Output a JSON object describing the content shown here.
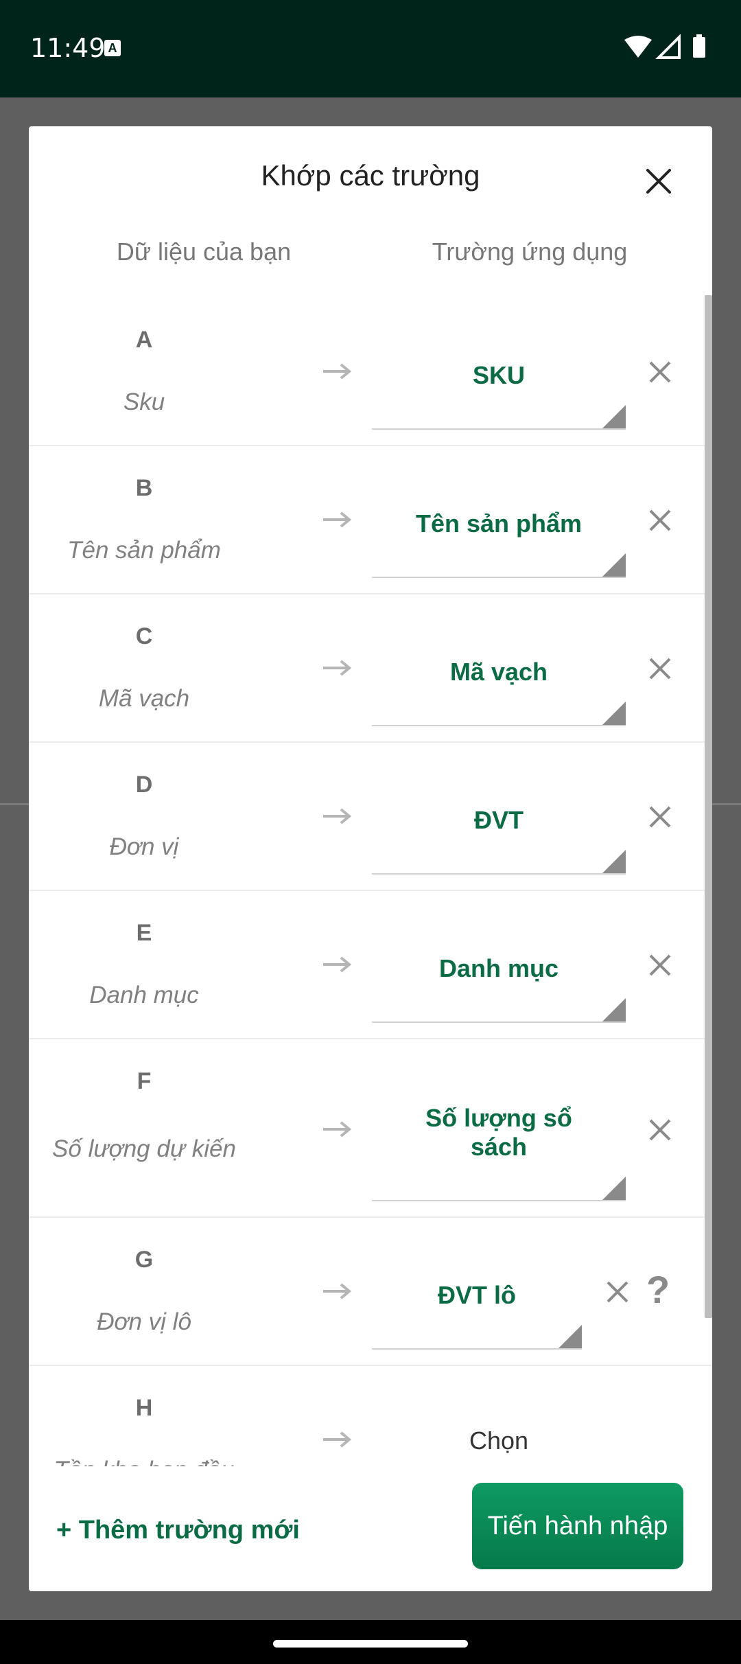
{
  "status_bar": {
    "time": "11:49"
  },
  "dialog": {
    "title": "Khớp các trường",
    "col_source": "Dữ liệu của bạn",
    "col_target": "Trường ứng dụng",
    "rows": [
      {
        "letter": "A",
        "source": "Sku",
        "target": "SKU"
      },
      {
        "letter": "B",
        "source": "Tên sản phẩm",
        "target": "Tên sản phẩm"
      },
      {
        "letter": "C",
        "source": "Mã vạch",
        "target": "Mã vạch"
      },
      {
        "letter": "D",
        "source": "Đơn vị",
        "target": "ĐVT"
      },
      {
        "letter": "E",
        "source": "Danh mục",
        "target": "Danh mục"
      },
      {
        "letter": "F",
        "source": "Số lượng dự kiến",
        "target_line1": "Số lượng sổ",
        "target_line2": "sách"
      },
      {
        "letter": "G",
        "source": "Đơn vị lô",
        "target": "ĐVT lô",
        "help": "?"
      },
      {
        "letter": "H",
        "source": "Tồn kho ban đầu",
        "target": "Chọn"
      }
    ],
    "add_field_label": "+ Thêm trường mới",
    "import_label": "Tiến hành nhập"
  },
  "colors": {
    "accent": "#0b6b45",
    "button": "#067a4a",
    "status_bar": "#00231a"
  }
}
